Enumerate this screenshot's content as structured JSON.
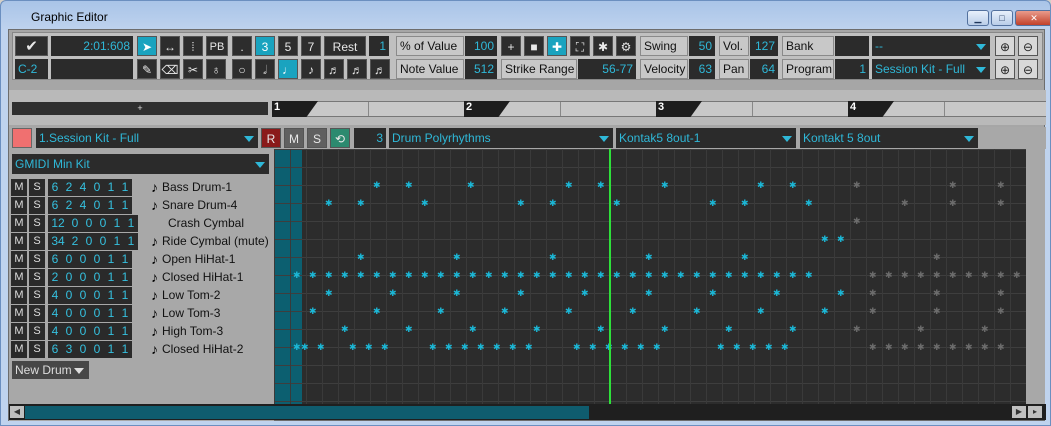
{
  "window": {
    "title": "Graphic Editor"
  },
  "toolbar": {
    "time": "2:01:608",
    "pitch": "C-2",
    "pb": "PB",
    "dot": ".",
    "q3": "3",
    "q5": "5",
    "q7": "7",
    "rest": "Rest",
    "rest_value": "1",
    "percent_label": "% of Value",
    "percent_value": "100",
    "note_value_label": "Note Value",
    "note_value": "512",
    "strike_label": "Strike Range",
    "strike_value": "56-77",
    "swing_label": "Swing",
    "swing_value": "50",
    "velocity_label": "Velocity",
    "velocity_value": "63",
    "vol_label": "Vol.",
    "vol_value": "127",
    "pan_label": "Pan",
    "pan_value": "64",
    "bank_label": "Bank",
    "bank_value": "--",
    "program_label": "Program",
    "program_value": "1",
    "program_name": "Session Kit - Full"
  },
  "ruler": {
    "add": "+",
    "bars": [
      "1",
      "2",
      "3",
      "4"
    ]
  },
  "track": {
    "name": "1.Session Kit - Full",
    "rec": "R",
    "mute": "M",
    "solo": "S",
    "channel": "3",
    "pattern": "Drum Polyrhythms",
    "output": "Kontak5 8out-1",
    "instrument": "Kontakt 5 8out"
  },
  "kit": {
    "name": "GMIDI Min Kit",
    "new_drum": "New Drum"
  },
  "rows": [
    {
      "m": "M",
      "s": "S",
      "v": [
        "6",
        "2",
        "4",
        "0",
        "1",
        "1"
      ],
      "name": "Bass Drum-1"
    },
    {
      "m": "M",
      "s": "S",
      "v": [
        "6",
        "2",
        "4",
        "0",
        "1",
        "1"
      ],
      "name": "Snare Drum-4"
    },
    {
      "m": "M",
      "s": "S",
      "v": [
        "12",
        "0",
        "0",
        "0",
        "1",
        "1"
      ],
      "name": "Crash Cymbal"
    },
    {
      "m": "M",
      "s": "S",
      "v": [
        "34",
        "2",
        "0",
        "0",
        "1",
        "1"
      ],
      "name": "Ride Cymbal (mute)"
    },
    {
      "m": "M",
      "s": "S",
      "v": [
        "6",
        "0",
        "0",
        "0",
        "1",
        "1"
      ],
      "name": "Open HiHat-1"
    },
    {
      "m": "M",
      "s": "S",
      "v": [
        "2",
        "0",
        "0",
        "0",
        "1",
        "1"
      ],
      "name": "Closed HiHat-1"
    },
    {
      "m": "M",
      "s": "S",
      "v": [
        "4",
        "0",
        "0",
        "0",
        "1",
        "1"
      ],
      "name": "Low Tom-2"
    },
    {
      "m": "M",
      "s": "S",
      "v": [
        "4",
        "0",
        "0",
        "0",
        "1",
        "1"
      ],
      "name": "Low Tom-3"
    },
    {
      "m": "M",
      "s": "S",
      "v": [
        "4",
        "0",
        "0",
        "0",
        "1",
        "1"
      ],
      "name": "High Tom-3"
    },
    {
      "m": "M",
      "s": "S",
      "v": [
        "6",
        "3",
        "0",
        "0",
        "1",
        "1"
      ],
      "name": "Closed HiHat-2"
    }
  ]
}
